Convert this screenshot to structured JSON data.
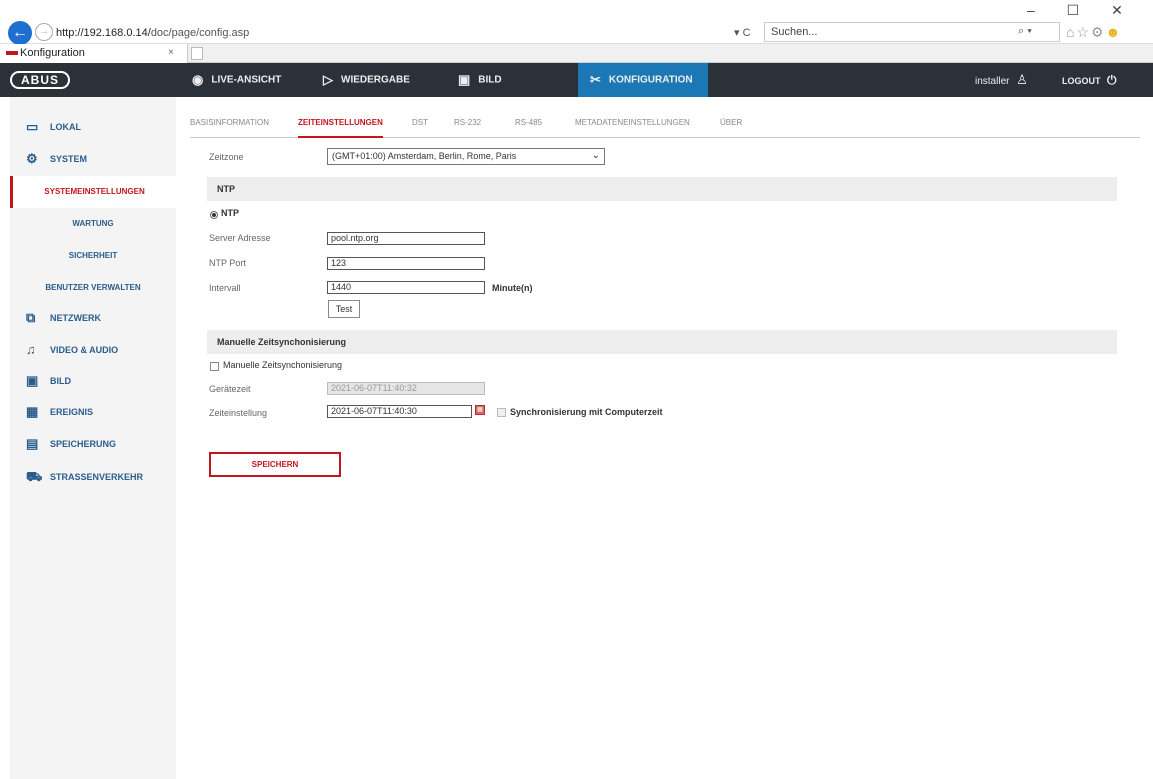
{
  "browser": {
    "url_prefix": "http://192.168.0.14/",
    "url_path": "doc/page/config.asp",
    "url_tools": "▾ C",
    "search_placeholder": "Suchen...",
    "search_drop": "⌕ ▾",
    "win_controls": "– ☐ ✕",
    "fav_icons": "⌂☆⚙",
    "tab_title": "Konfiguration",
    "tab_close": "×",
    "back_icon": "←",
    "fwd_icon": "→",
    "fav_smile": "☻"
  },
  "brand": {
    "logo": "ABUS"
  },
  "nav": {
    "live": "LIVE-ANSICHT",
    "playback": "WIEDERGABE",
    "image": "BILD",
    "config": "KONFIGURATION",
    "user": "installer",
    "logout": "LOGOUT",
    "icons": {
      "live": "◉",
      "playback": "▷",
      "image": "▣",
      "config": "✂",
      "user": "♙",
      "logout": "⏻"
    }
  },
  "sidebar": {
    "lokal": "LOKAL",
    "system": "SYSTEM",
    "sub_systemsettings": "SYSTEMEINSTELLUNGEN",
    "sub_wartung": "WARTUNG",
    "sub_sicherheit": "SICHERHEIT",
    "sub_benutzer": "BENUTZER VERWALTEN",
    "netzwerk": "NETZWERK",
    "video_audio": "VIDEO & AUDIO",
    "bild": "BILD",
    "ereignis": "EREIGNIS",
    "speicherung": "SPEICHERUNG",
    "strassenverkehr": "STRAßENVERKEHR",
    "icons": {
      "lokal": "▭",
      "system": "⚙",
      "netzwerk": "⧉",
      "video_audio": "♫",
      "bild": "▣",
      "ereignis": "▦",
      "speicherung": "▤",
      "strassenverkehr": "⛟"
    }
  },
  "tabs": {
    "basis": "BASISINFORMATION",
    "zeit": "ZEITEINSTELLUNGEN",
    "dst": "DST",
    "rs232": "RS-232",
    "rs485": "RS-485",
    "meta": "METADATENEINSTELLUNGEN",
    "ueber": "ÜBER"
  },
  "form": {
    "timezone_label": "Zeitzone",
    "timezone_value": "(GMT+01:00) Amsterdam, Berlin, Rome, Paris",
    "ntp_section": "NTP",
    "ntp_radio_label": "NTP",
    "server_label": "Server Adresse",
    "server_value": "pool.ntp.org",
    "port_label": "NTP Port",
    "port_value": "123",
    "interval_label": "Intervall",
    "interval_value": "1440",
    "interval_unit": "Minute(n)",
    "test_button": "Test",
    "manual_section": "Manuelle Zeitsynchonisierung",
    "manual_checkbox_label": "Manuelle Zeitsynchonisierung",
    "device_time_label": "Gerätezeit",
    "device_time_value": "2021-06-07T11:40:32",
    "time_setting_label": "Zeiteinstellung",
    "time_setting_value": "2021-06-07T11:40:30",
    "sync_pc_label": "Synchronisierung mit Computerzeit",
    "save_button": "SPEICHERN",
    "select_arrow": "⌄",
    "calendar_icon": "▦"
  }
}
